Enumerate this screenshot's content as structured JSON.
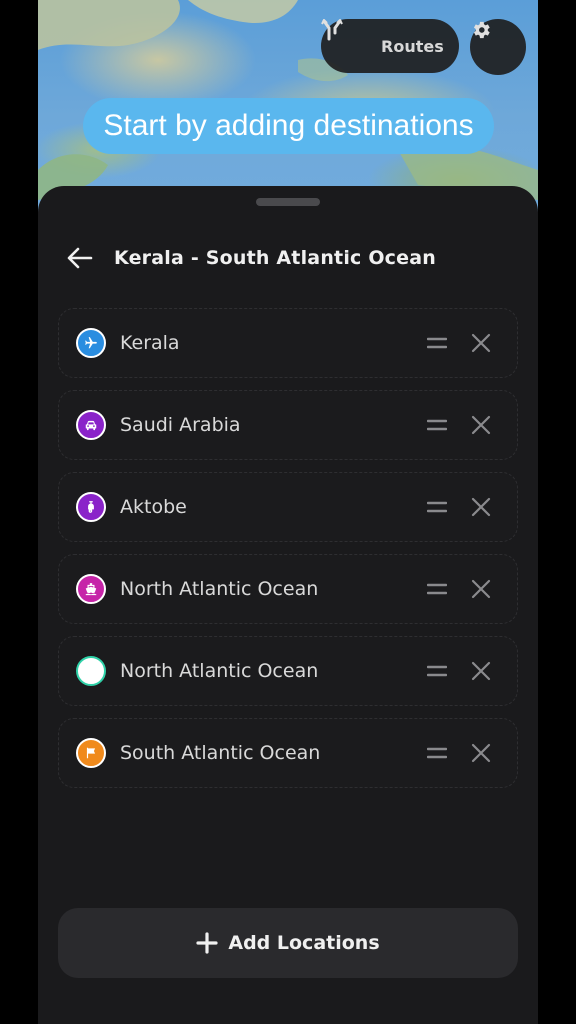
{
  "header": {
    "routes_label": "Routes",
    "hint": "Start by adding destinations"
  },
  "sheet": {
    "title": "Kerala - South Atlantic Ocean",
    "stops": [
      {
        "label": "Kerala",
        "icon": "airplane-icon",
        "color": "#2a8de0"
      },
      {
        "label": "Saudi Arabia",
        "icon": "car-icon",
        "color": "#8a23c9"
      },
      {
        "label": "Aktobe",
        "icon": "scooter-icon",
        "color": "#8a23c9"
      },
      {
        "label": "North Atlantic Ocean",
        "icon": "ship-icon",
        "color": "#c625a8"
      },
      {
        "label": "North Atlantic Ocean",
        "icon": "circle-marker-icon",
        "color": "#2fd1a8"
      },
      {
        "label": "South Atlantic Ocean",
        "icon": "flag-icon",
        "color": "#f08a1c"
      }
    ],
    "add_label": "Add Locations"
  }
}
